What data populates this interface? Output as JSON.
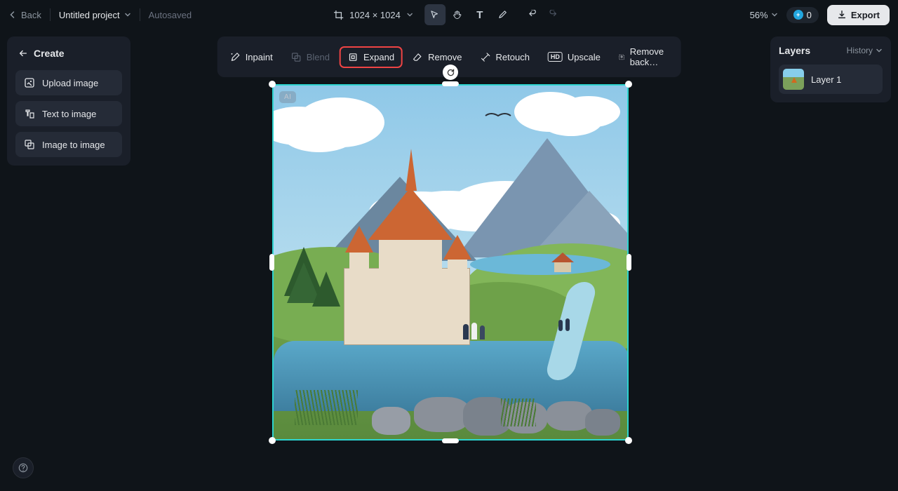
{
  "topbar": {
    "back": "Back",
    "project": "Untitled project",
    "autosaved": "Autosaved",
    "dimensions": "1024 × 1024",
    "zoom": "56%",
    "credits": "0",
    "export": "Export"
  },
  "sidebar": {
    "create": "Create",
    "upload": "Upload image",
    "text2img": "Text to image",
    "img2img": "Image to image"
  },
  "actions": {
    "inpaint": "Inpaint",
    "blend": "Blend",
    "expand": "Expand",
    "remove": "Remove",
    "retouch": "Retouch",
    "upscale": "Upscale",
    "upscale_badge": "HD",
    "removebg": "Remove back…"
  },
  "canvas": {
    "ai_badge": "AI"
  },
  "layers": {
    "title": "Layers",
    "history": "History",
    "layer1": "Layer 1"
  }
}
